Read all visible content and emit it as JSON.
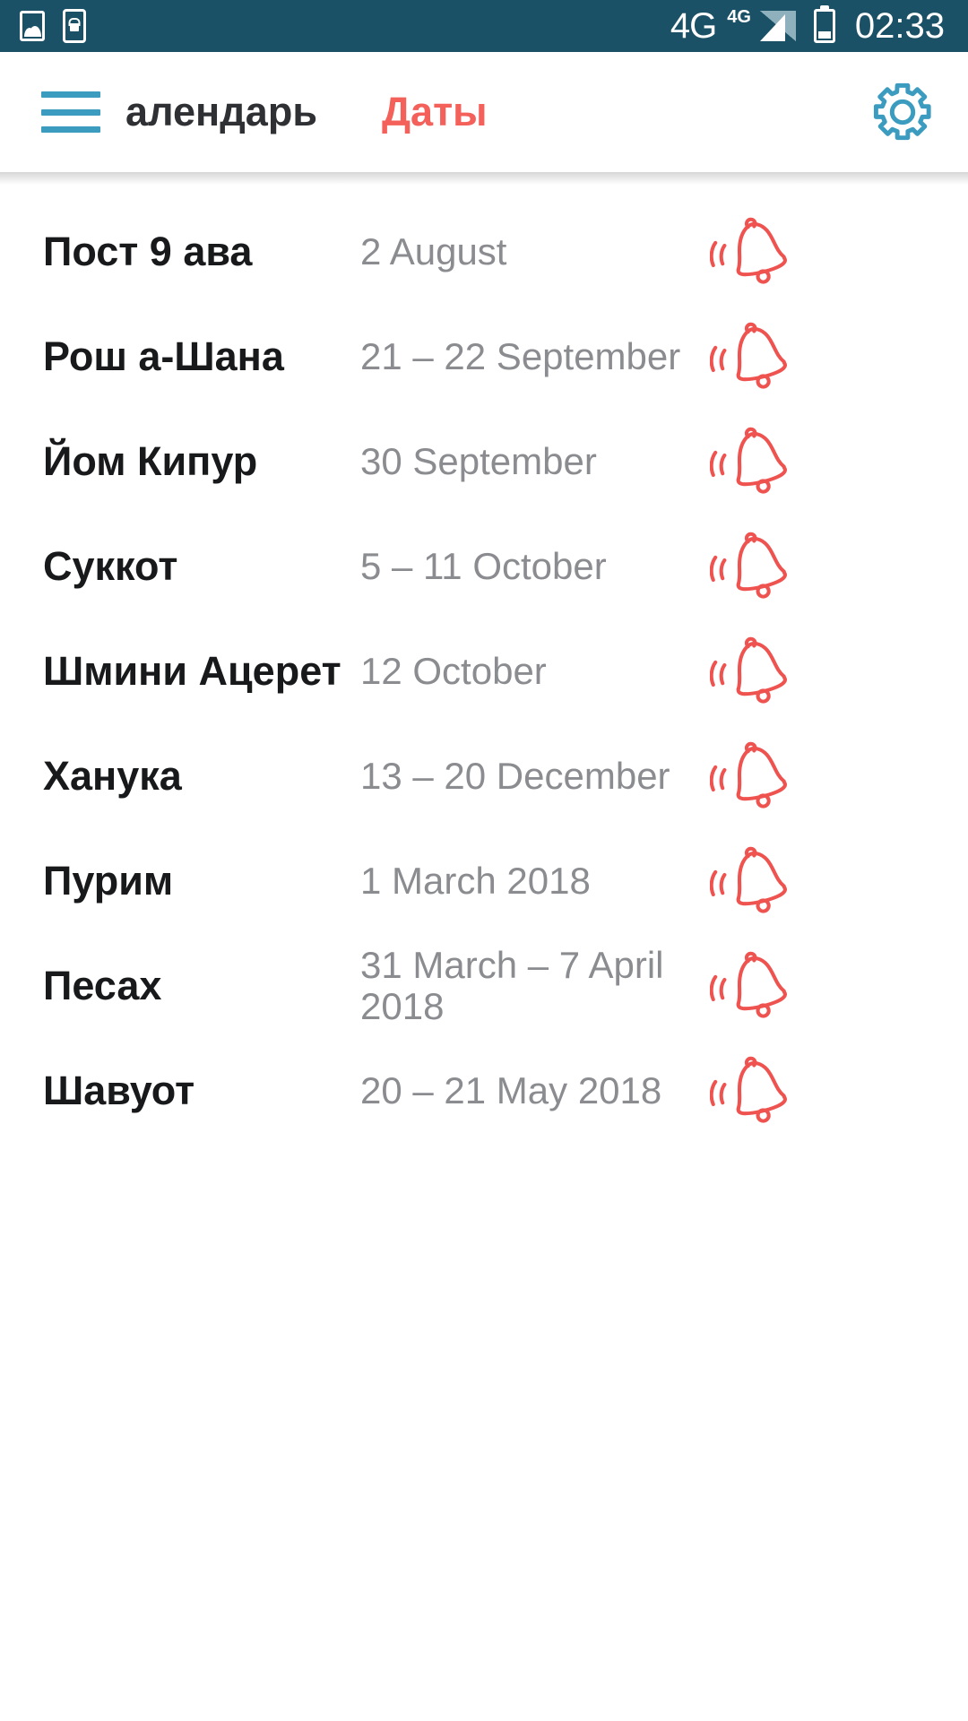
{
  "status_bar": {
    "background": "#1a5166",
    "icons": [
      "image-icon",
      "phone-lock-icon"
    ],
    "network_big": "4G",
    "network_small": "4G",
    "time": "02:33"
  },
  "app_bar": {
    "menu_icon": "hamburger-menu-icon",
    "menu_color": "#3b9cc0",
    "settings_icon": "gear-icon",
    "settings_color": "#3b9cc0",
    "tabs": [
      {
        "label": "Календарь",
        "active": false,
        "color": "#2f3033"
      },
      {
        "label": "Даты",
        "active": true,
        "color": "#f4605a"
      }
    ]
  },
  "list": {
    "bell_icon": "alarm-bell-icon",
    "bell_color": "#ef5350",
    "rows": [
      {
        "name": "Пост 9 ава",
        "date": "2 August"
      },
      {
        "name": "Рош а-Шана",
        "date": "21 – 22 September"
      },
      {
        "name": "Йом Кипур",
        "date": "30 September"
      },
      {
        "name": "Суккот",
        "date": "5 – 11 October"
      },
      {
        "name": "Шмини Ацерет",
        "date": "12 October"
      },
      {
        "name": "Ханука",
        "date": "13 – 20 December"
      },
      {
        "name": "Пурим",
        "date": "1 March 2018"
      },
      {
        "name": "Песах",
        "date": "31 March – 7 April 2018"
      },
      {
        "name": "Шавуот",
        "date": "20 – 21 May 2018"
      }
    ]
  }
}
